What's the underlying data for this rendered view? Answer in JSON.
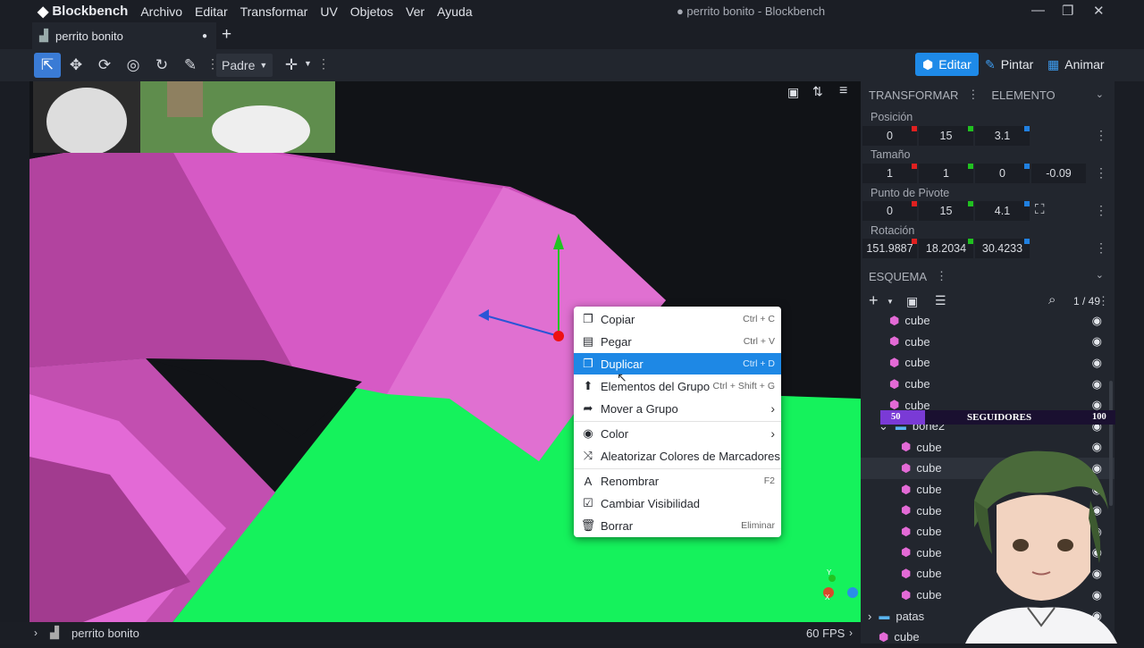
{
  "app": {
    "name": "Blockbench",
    "window_title": "● perrito bonito - Blockbench",
    "menu": [
      "Archivo",
      "Editar",
      "Transformar",
      "UV",
      "Objetos",
      "Ver",
      "Ayuda"
    ]
  },
  "tabs": [
    {
      "label": "perrito bonito"
    }
  ],
  "toolbar": {
    "dropdown_value": "Padre",
    "modes": [
      "Editar",
      "Pintar",
      "Animar"
    ]
  },
  "context_menu": {
    "items": [
      {
        "label": "Copiar",
        "shortcut": "Ctrl + C",
        "icon": "copy-icon"
      },
      {
        "label": "Pegar",
        "shortcut": "Ctrl + V",
        "icon": "paste-icon"
      },
      {
        "label": "Duplicar",
        "shortcut": "Ctrl + D",
        "icon": "duplicate-icon",
        "highlighted": true
      },
      {
        "label": "Elementos del Grupo",
        "shortcut": "Ctrl + Shift + G",
        "icon": "group-icon"
      },
      {
        "label": "Mover a Grupo",
        "shortcut": "",
        "icon": "move-to-group-icon",
        "submenu": true
      },
      {
        "label": "Color",
        "shortcut": "",
        "icon": "palette-icon",
        "submenu": true
      },
      {
        "label": "Aleatorizar Colores de Marcadores",
        "shortcut": "",
        "icon": "shuffle-icon"
      },
      {
        "label": "Renombrar",
        "shortcut": "F2",
        "icon": "rename-icon"
      },
      {
        "label": "Cambiar Visibilidad",
        "shortcut": "",
        "icon": "checkbox-icon"
      },
      {
        "label": "Borrar",
        "shortcut": "Eliminar",
        "icon": "trash-icon"
      }
    ]
  },
  "panel": {
    "tabs": [
      "TRANSFORMAR",
      "ELEMENTO"
    ],
    "fields": {
      "position": {
        "label": "Posición",
        "values": [
          "0",
          "15",
          "3.1"
        ]
      },
      "size": {
        "label": "Tamaño",
        "values": [
          "1",
          "1",
          "0",
          "-0.09"
        ]
      },
      "pivot": {
        "label": "Punto de Pivote",
        "values": [
          "0",
          "15",
          "4.1"
        ]
      },
      "rotation": {
        "label": "Rotación",
        "values": [
          "151.9887",
          "18.2034",
          "30.4233"
        ]
      }
    },
    "outliner": {
      "title": "ESQUEMA",
      "count": "1 / 49",
      "rows": [
        {
          "label": "cube",
          "type": "cube",
          "indent": 1
        },
        {
          "label": "cube",
          "type": "cube",
          "indent": 1
        },
        {
          "label": "cube",
          "type": "cube",
          "indent": 1
        },
        {
          "label": "cube",
          "type": "cube",
          "indent": 1
        },
        {
          "label": "cube",
          "type": "cube",
          "indent": 1
        },
        {
          "label": "bone2",
          "type": "group",
          "indent": 1
        },
        {
          "label": "cube",
          "type": "cube",
          "indent": 2
        },
        {
          "label": "cube",
          "type": "cube",
          "indent": 2,
          "selected": true
        },
        {
          "label": "cube",
          "type": "cube",
          "indent": 2
        },
        {
          "label": "cube",
          "type": "cube",
          "indent": 2
        },
        {
          "label": "cube",
          "type": "cube",
          "indent": 2
        },
        {
          "label": "cube",
          "type": "cube",
          "indent": 2
        },
        {
          "label": "cube",
          "type": "cube",
          "indent": 2
        },
        {
          "label": "cube",
          "type": "cube",
          "indent": 2
        },
        {
          "label": "patas",
          "type": "group",
          "indent": 0
        },
        {
          "label": "cube",
          "type": "cube",
          "indent": 0
        }
      ]
    }
  },
  "followers_overlay": {
    "min": "50",
    "label": "SEGUIDORES",
    "max": "100"
  },
  "status": {
    "project": "perrito bonito",
    "fps": "60 FPS"
  },
  "colors": {
    "accent": "#1e88e5",
    "model_pink": "#e36ad6",
    "ground_green": "#15f25c"
  }
}
